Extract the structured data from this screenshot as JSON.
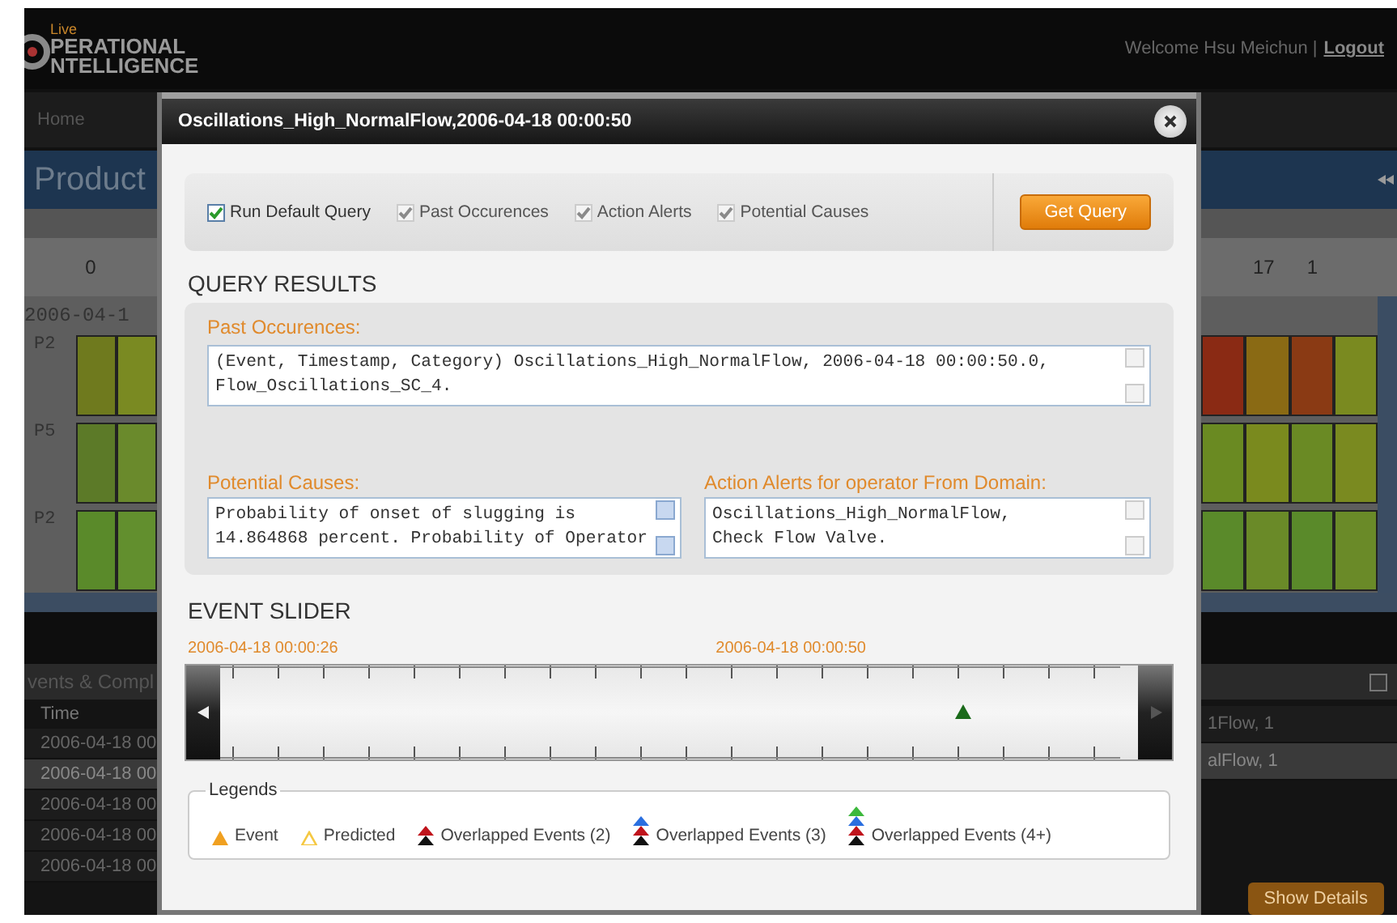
{
  "header": {
    "logo_small": "Live",
    "logo_line1": "PERATIONAL",
    "logo_line2": "NTELLIGENCE",
    "welcome": "Welcome Hsu Meichun |",
    "logout": "Logout"
  },
  "nav": {
    "items": [
      {
        "label": "Home"
      }
    ]
  },
  "page_title": "Product",
  "heatmap": {
    "left_tick": "0",
    "right_ticks": [
      "17",
      "1"
    ],
    "date": "2006-04-1",
    "rows": [
      {
        "label": "P2"
      },
      {
        "label": "P5"
      },
      {
        "label": "P2"
      }
    ]
  },
  "events_panel": {
    "title": "vents & Compl",
    "column": "Time",
    "rows": [
      {
        "time": "2006-04-18 00",
        "detail": "1Flow, 1",
        "selected": false
      },
      {
        "time": "2006-04-18 00",
        "detail": "alFlow, 1",
        "selected": true
      },
      {
        "time": "2006-04-18 00",
        "selected": false
      },
      {
        "time": "2006-04-18 00",
        "selected": false
      },
      {
        "time": "2006-04-18 00",
        "selected": false
      }
    ],
    "button": "Show Details"
  },
  "dialog": {
    "title": "Oscillations_High_NormalFlow,2006-04-18 00:00:50",
    "options": [
      {
        "label": "Run Default Query",
        "checked": true,
        "disabled": false
      },
      {
        "label": "Past Occurences",
        "checked": true,
        "disabled": true
      },
      {
        "label": "Action Alerts",
        "checked": true,
        "disabled": true
      },
      {
        "label": "Potential Causes",
        "checked": true,
        "disabled": true
      }
    ],
    "get_query": "Get Query",
    "results_heading": "QUERY RESULTS",
    "past": {
      "label": "Past Occurences:",
      "lines": [
        "(Event, Timestamp, Category) Oscillations_High_NormalFlow, 2006-04-18 00:00:50.0,",
        "Flow_Oscillations_SC_4."
      ],
      "scrollable": false
    },
    "causes": {
      "label": "Potential Causes:",
      "lines": [
        "Probability of onset of slugging is",
        "14.864868 percent. Probability of Operator"
      ],
      "scrollable": true
    },
    "alerts": {
      "label": "Action Alerts for operator From Domain:",
      "lines": [
        "Oscillations_High_NormalFlow,",
        "Check Flow Valve."
      ],
      "scrollable": false
    },
    "slider_heading": "EVENT SLIDER",
    "slider": {
      "level": 0.78
    },
    "start_time": "2006-04-18 00:00:26",
    "end_time": "2006-04-18 00:00:50",
    "legend_title": "Legends",
    "legend": [
      {
        "label": "Event",
        "kind": "solid",
        "markers": [
          {
            "color": "#f0a020"
          }
        ]
      },
      {
        "label": "Predicted",
        "kind": "hollow",
        "markers": [
          {
            "color": "#f5c842"
          }
        ]
      },
      {
        "label": "Overlapped Events (2)",
        "kind": "stack",
        "markers": [
          {
            "color": "#c0141c"
          },
          {
            "color": "#111111"
          }
        ]
      },
      {
        "label": "Overlapped Events (3)",
        "kind": "stack",
        "markers": [
          {
            "color": "#2a6fe0"
          },
          {
            "color": "#c0141c"
          },
          {
            "color": "#111111"
          }
        ]
      },
      {
        "label": "Overlapped Events (4+)",
        "kind": "stack",
        "markers": [
          {
            "color": "#3cb83c"
          },
          {
            "color": "#2a6fe0"
          },
          {
            "color": "#c0141c"
          },
          {
            "color": "#111111"
          }
        ]
      }
    ]
  }
}
